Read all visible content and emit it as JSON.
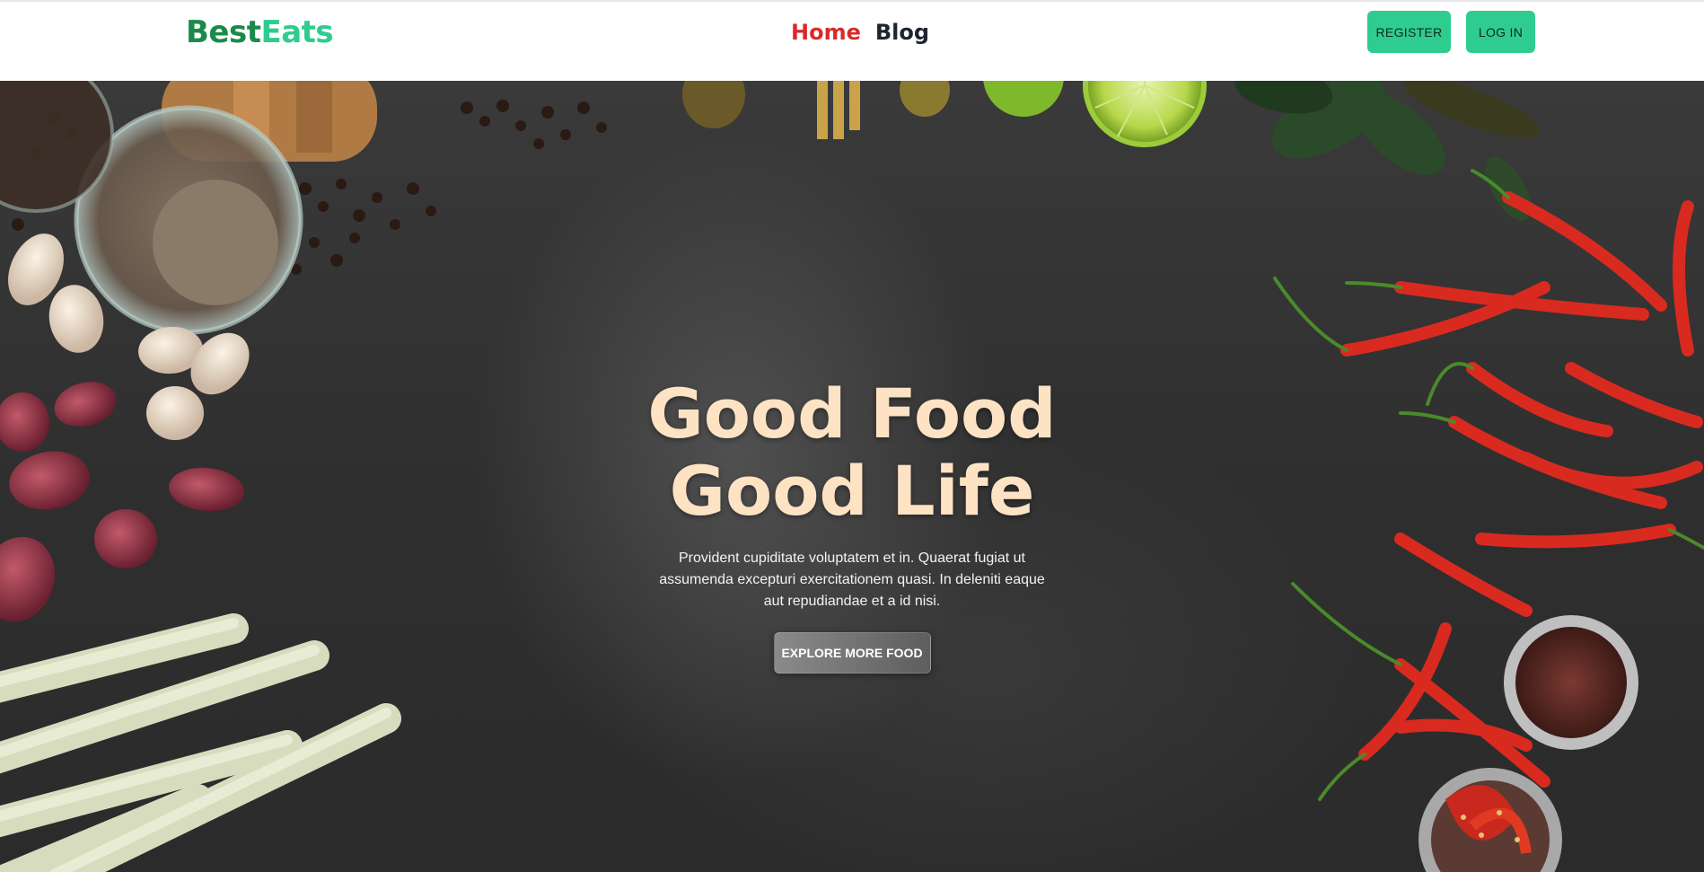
{
  "header": {
    "logo_part1": "Best",
    "logo_part2": "Eats",
    "nav": {
      "home_label": "Home",
      "blog_label": "Blog"
    },
    "register_label": "REGISTER",
    "login_label": "LOG IN"
  },
  "hero": {
    "title_line1": "Good Food",
    "title_line2": "Good Life",
    "description": "Provident cupiditate voluptatem et in. Quaerat fugiat ut assumenda excepturi exercitationem quasi. In deleniti eaque aut repudiandae et a id nisi.",
    "cta_label": "EXPLORE MORE FOOD",
    "background_image": "food-ingredients-on-dark-table-image"
  },
  "colors": {
    "brand_dark": "#1a8a4a",
    "brand_light": "#2ecc8f",
    "nav_active": "#d92a2a",
    "nav_inactive": "#1f2530",
    "hero_title": "#fde3c4"
  }
}
